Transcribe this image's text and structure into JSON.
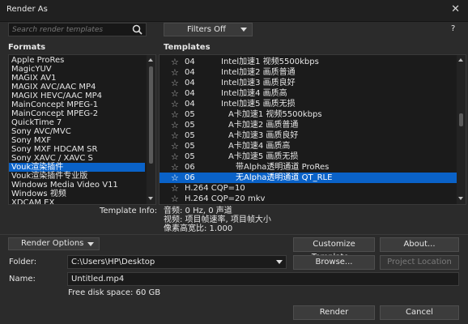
{
  "window": {
    "title": "Render As",
    "close_glyph": "✕",
    "help_glyph": "?"
  },
  "search": {
    "placeholder": "Search render templates",
    "icon": "search-icon"
  },
  "filters": {
    "label": "Filters Off"
  },
  "formats": {
    "header": "Formats",
    "items": [
      "Apple ProRes",
      "MagicYUV",
      "MAGIX AV1",
      "MAGIX AVC/AAC MP4",
      "MAGIX HEVC/AAC MP4",
      "MainConcept MPEG-1",
      "MainConcept MPEG-2",
      "QuickTime 7",
      "Sony AVC/MVC",
      "Sony MXF",
      "Sony MXF HDCAM SR",
      "Sony XAVC / XAVC S",
      "Vouk渲染插件",
      "Vouk渲染插件专业版",
      "Windows Media Video V11",
      "Windows 视频",
      "XDCAM EX"
    ],
    "selected_index": 12
  },
  "templates": {
    "header": "Templates",
    "items": [
      {
        "num": "04",
        "name": "Intel加速1  视频5500kbps"
      },
      {
        "num": "04",
        "name": "Intel加速2  画质普通"
      },
      {
        "num": "04",
        "name": "Intel加速3  画质良好"
      },
      {
        "num": "04",
        "name": "Intel加速4  画质高"
      },
      {
        "num": "04",
        "name": "Intel加速5  画质无损"
      },
      {
        "num": "05",
        "name": "A卡加速1  视频5500kbps"
      },
      {
        "num": "05",
        "name": "A卡加速2  画质普通"
      },
      {
        "num": "05",
        "name": "A卡加速3  画质良好"
      },
      {
        "num": "05",
        "name": "A卡加速4  画质高"
      },
      {
        "num": "05",
        "name": "A卡加速5  画质无损"
      },
      {
        "num": "06",
        "name": "带Alpha透明通道   ProRes"
      },
      {
        "num": "06",
        "name": "无Alpha透明通道   QT_RLE"
      },
      {
        "num": "",
        "name": "H.264 CQP=10"
      },
      {
        "num": "",
        "name": "H.264 CQP=20 mkv"
      }
    ],
    "selected_index": 11
  },
  "template_info": {
    "label": "Template Info:",
    "lines": [
      "音频: 0 Hz, 0 声道",
      "视频: 项目帧速率, 项目帧大小",
      "像素高宽比: 1.000"
    ]
  },
  "buttons": {
    "render_options": "Render Options",
    "customize": "Customize Template...",
    "about": "About...",
    "browse": "Browse...",
    "project_location": "Project Location",
    "render": "Render",
    "cancel": "Cancel"
  },
  "folder": {
    "label": "Folder:",
    "value": "C:\\Users\\HP\\Desktop"
  },
  "name": {
    "label": "Name:",
    "value": "Untitled.mp4"
  },
  "disk": {
    "text": "Free disk space: 60 GB"
  },
  "colors": {
    "accent": "#0a62c8",
    "background": "#2b2b2b",
    "panel": "#1b1b1b"
  }
}
